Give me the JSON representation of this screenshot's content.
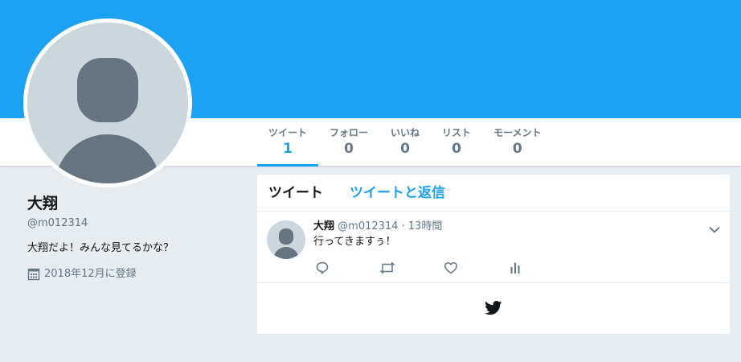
{
  "colors": {
    "brand": "#1da1f2",
    "banner": "#1da1f2",
    "page_background": "#e6ecf0",
    "text_primary": "#14171a",
    "text_secondary": "#657786"
  },
  "nav": {
    "stats": [
      {
        "label": "ツイート",
        "value": "1",
        "active": true
      },
      {
        "label": "フォロー",
        "value": "0",
        "active": false
      },
      {
        "label": "いいね",
        "value": "0",
        "active": false
      },
      {
        "label": "リスト",
        "value": "0",
        "active": false
      },
      {
        "label": "モーメント",
        "value": "0",
        "active": false
      }
    ]
  },
  "profile": {
    "avatar_icon": "default-profile-avatar-icon",
    "name": "大翔",
    "handle": "@m012314",
    "bio": "大翔だよ！みんな見てるかな？",
    "joined_icon": "calendar-icon",
    "joined": "2018年12月に登録"
  },
  "timeline": {
    "tabs": {
      "tweets": "ツイート",
      "tweets_and_replies": "ツイートと返信"
    },
    "tweet": {
      "author": "大翔",
      "handle": "@m012314",
      "separator": "·",
      "time": "13時間",
      "text": "行ってきますぅ！",
      "caret_icon": "chevron-down-icon",
      "actions": [
        "reply-icon",
        "retweet-icon",
        "like-icon",
        "analytics-icon"
      ]
    },
    "footer_icon": "twitter-bird-icon"
  }
}
